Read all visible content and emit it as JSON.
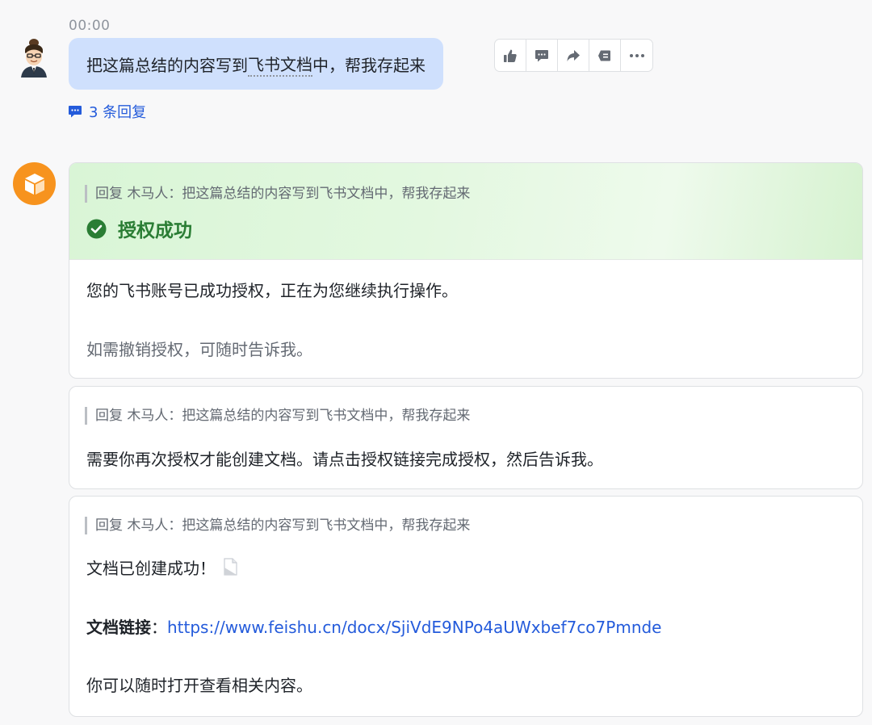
{
  "timestamp": "00:00",
  "user_message": {
    "text_before": "把这篇总结的内容写到",
    "text_dotted": "飞书文档",
    "text_after": "中，帮我存起来"
  },
  "toolbar": {
    "icons": [
      "thumbs-up-icon",
      "comment-icon",
      "forward-icon",
      "pin-icon",
      "more-icon"
    ]
  },
  "replies_label": "3 条回复",
  "quote_text": "回复 木马人：把这篇总结的内容写到飞书文档中，帮我存起来",
  "card1": {
    "title": "授权成功",
    "line1": "您的飞书账号已成功授权，正在为您继续执行操作。",
    "line2": "如需撤销授权，可随时告诉我。"
  },
  "card2": {
    "line1": "需要你再次授权才能创建文档。请点击授权链接完成授权，然后告诉我。"
  },
  "card3": {
    "line1": "文档已创建成功！",
    "link_label": "文档链接",
    "link_sep": "：",
    "link_url": "https://www.feishu.cn/docx/SjiVdE9NPo4aUWxbef7co7Pmnde",
    "line3": "你可以随时打开查看相关内容。"
  },
  "colors": {
    "accent": "#245bdb",
    "success": "#2a7d34",
    "user_bubble": "#cfe0fd",
    "bot_avatar": "#f7931e"
  }
}
